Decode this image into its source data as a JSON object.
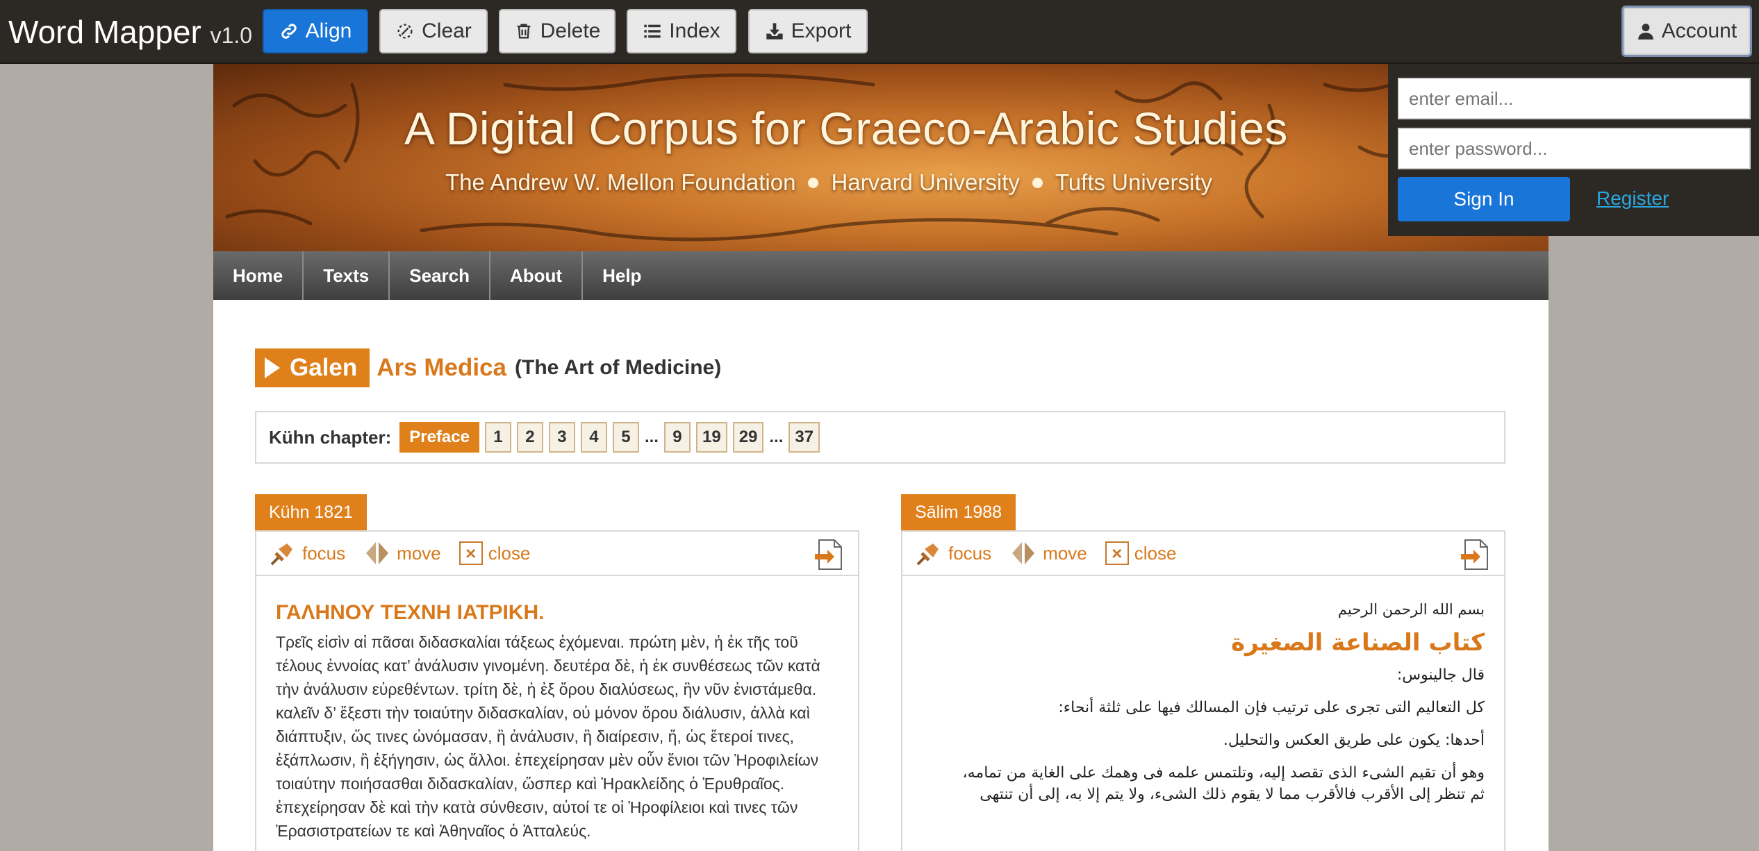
{
  "toolbar": {
    "brand": "Word Mapper",
    "version": "v1.0",
    "align_label": "Align",
    "clear_label": "Clear",
    "delete_label": "Delete",
    "index_label": "Index",
    "export_label": "Export",
    "account_label": "Account"
  },
  "login": {
    "email_placeholder": "enter email...",
    "password_placeholder": "enter password...",
    "signin_label": "Sign In",
    "register_label": "Register"
  },
  "banner": {
    "title": "A Digital Corpus for Graeco-Arabic Studies",
    "sponsors": [
      "The Andrew W. Mellon Foundation",
      "Harvard University",
      "Tufts University"
    ]
  },
  "nav": {
    "items": [
      "Home",
      "Texts",
      "Search",
      "About",
      "Help"
    ]
  },
  "work": {
    "author": "Galen",
    "title": "Ars Medica",
    "english_title": "(The Art of Medicine)"
  },
  "chapters": {
    "label": "Kühn chapter:",
    "active": "Preface",
    "items_a": [
      "1",
      "2",
      "3",
      "4",
      "5"
    ],
    "ellipsis": "...",
    "items_b": [
      "9",
      "19",
      "29"
    ],
    "items_c": [
      "37"
    ]
  },
  "panels": {
    "tool_focus": "focus",
    "tool_move": "move",
    "tool_close": "close",
    "left": {
      "tab": "Kühn 1821",
      "heading": "ΓΑΛΗΝΟΥ ΤΕΧΝΗ ΙΑΤΡΙΚΗ.",
      "text": "Τρεῖς εἰσὶν αἱ πᾶσαι διδασκαλίαι τάξεως ἐχόμεναι. πρώτη μὲν, ἡ ἐκ τῆς τοῦ τέλους ἐννοίας κατ’ ἀνάλυσιν γινομένη. δευτέρα δὲ, ἡ ἐκ συνθέσεως τῶν κατὰ τὴν ἀνάλυσιν εὑρεθέντων. τρίτη δὲ, ἡ ἐξ ὅρου διαλύσεως, ἣν νῦν ἐνιστάμεθα. καλεῖν δ’ ἔξεστι τὴν τοιαύτην διδασκαλίαν, οὐ μόνον ὅρου διάλυσιν, ἀλλὰ καὶ διάπτυξιν, ὥς τινες ὠνόμασαν, ἢ ἀνάλυσιν, ἢ διαίρεσιν, ἤ, ὡς ἕτεροί τινες, ἐξάπλωσιν, ἢ ἐξήγησιν, ὡς ἄλλοι. ἐπεχείρησαν μὲν οὖν ἔνιοι τῶν Ἡροφιλείων τοιαύτην ποιήσασθαι διδασκαλίαν, ὥσπερ καὶ Ἡρακλείδης ὁ Ἐρυθραῖος. ἐπεχείρησαν δὲ καὶ τὴν κατὰ σύνθεσιν, αὐτοί τε οἱ Ἡροφίλειοι καὶ τινες τῶν Ἐρασιστρατείων τε καὶ Ἀθηναῖος ὁ Ἀτταλεύς."
    },
    "right": {
      "tab": "Sālim 1988",
      "basmala": "بسم الله الرحمن الرحيم",
      "heading": "كتاب الصناعة الصغيرة",
      "lines": [
        "قال جالينوس:",
        "كل التعاليم التى تجرى على ترتيب فإن المسالك فيها على ثلثة أنحاء:",
        "أحدها: يكون على طريق العكس والتحليل.",
        "وهو أن تقيم الشىء الذى تقصد إليه، وتلتمس علمه فى وهمك على الغاية من تمامه،",
        "ثم تنظر إلى الأقرب فالأقرب مما لا يقوم ذلك الشىء، ولا يتم إلا به، إلى أن تنتهى"
      ]
    }
  },
  "colors": {
    "accent": "#e0801a",
    "primary_button": "#1975d8",
    "toolbar": "#2c2824"
  },
  "icons": [
    "link-icon",
    "eraser-icon",
    "trash-icon",
    "list-icon",
    "download-icon",
    "user-icon",
    "pin-icon",
    "arrows-icon",
    "close-icon",
    "export-doc-icon"
  ]
}
